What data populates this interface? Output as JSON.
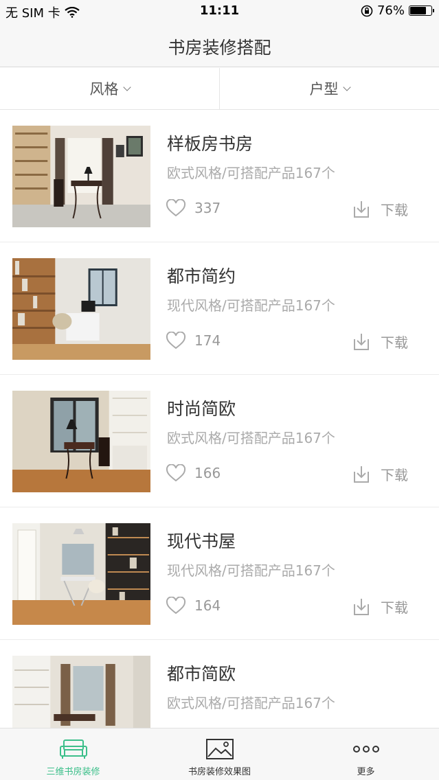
{
  "status_bar": {
    "carrier": "无 SIM 卡",
    "time": "11:11",
    "battery": "76%",
    "battery_level": 0.76
  },
  "nav": {
    "title": "书房装修搭配"
  },
  "filters": [
    {
      "label": "风格"
    },
    {
      "label": "户型"
    }
  ],
  "items": [
    {
      "title": "样板房书房",
      "subtitle": "欧式风格/可搭配产品167个",
      "likes": "337",
      "download": "下载"
    },
    {
      "title": "都市简约",
      "subtitle": "现代风格/可搭配产品167个",
      "likes": "174",
      "download": "下载"
    },
    {
      "title": "时尚简欧",
      "subtitle": "欧式风格/可搭配产品167个",
      "likes": "166",
      "download": "下载"
    },
    {
      "title": "现代书屋",
      "subtitle": "现代风格/可搭配产品167个",
      "likes": "164",
      "download": "下载"
    },
    {
      "title": "都市简欧",
      "subtitle": "欧式风格/可搭配产品167个",
      "likes": "",
      "download": ""
    }
  ],
  "tabs": [
    {
      "label": "三维书房装修",
      "icon": "sofa-icon",
      "active": true
    },
    {
      "label": "书房装修效果图",
      "icon": "picture-icon",
      "active": false
    },
    {
      "label": "更多",
      "icon": "more-dots-icon",
      "active": false
    }
  ],
  "colors": {
    "accent": "#3cbf8a",
    "text_primary": "#333333",
    "text_secondary": "#aaaaaa",
    "bar_background": "#f7f7f7"
  }
}
